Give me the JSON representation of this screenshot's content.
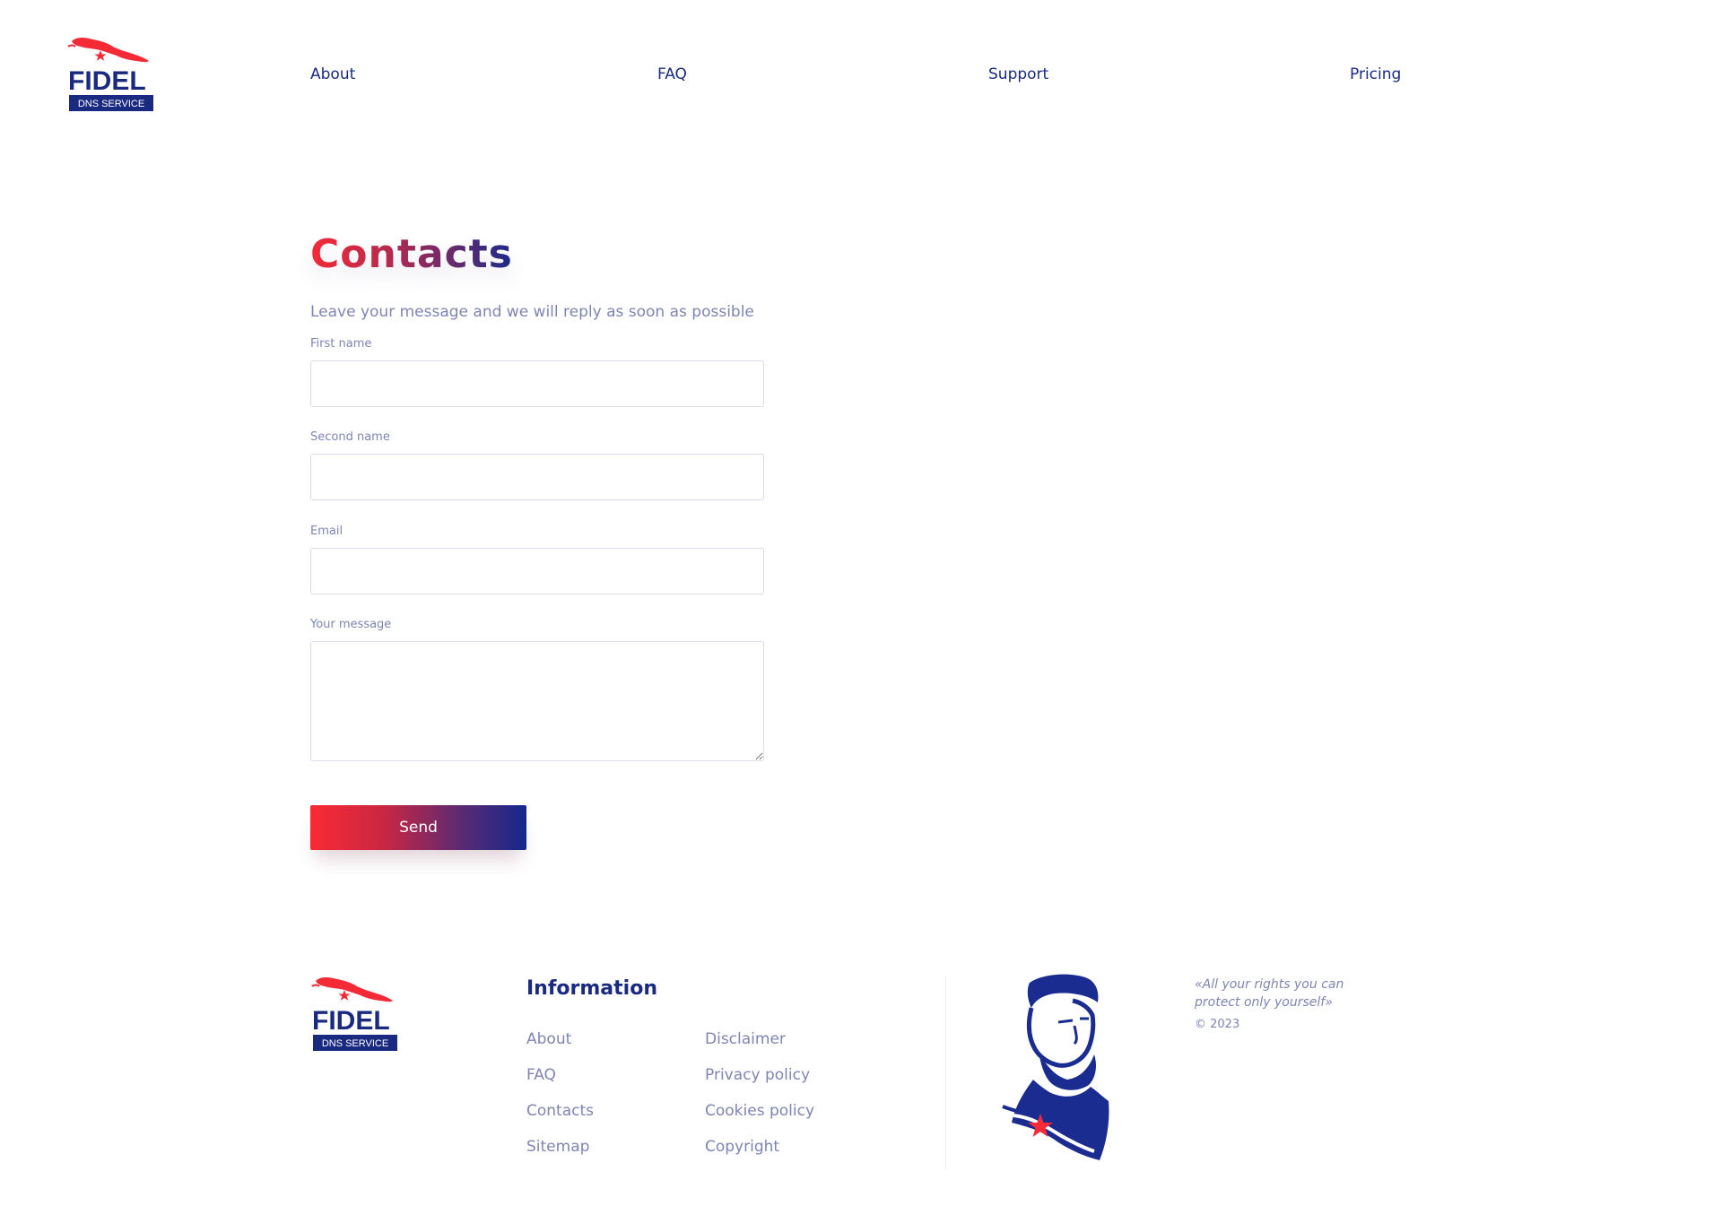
{
  "header": {
    "logo": {
      "word": "FIDEL",
      "tag": "DNS SERVICE"
    },
    "nav": [
      {
        "label": "About"
      },
      {
        "label": "FAQ"
      },
      {
        "label": "Support"
      },
      {
        "label": "Pricing"
      }
    ]
  },
  "contact": {
    "title": "Contacts",
    "subtitle": "Leave your message and we will reply as soon as possible",
    "fields": {
      "first_name": {
        "label": "First name",
        "value": ""
      },
      "second_name": {
        "label": "Second name",
        "value": ""
      },
      "email": {
        "label": "Email",
        "value": ""
      },
      "message": {
        "label": "Your message",
        "value": ""
      }
    },
    "send_label": "Send"
  },
  "footer": {
    "logo": {
      "word": "FIDEL",
      "tag": "DNS SERVICE"
    },
    "info_title": "Information",
    "links_col1": [
      "About",
      "FAQ",
      "Contacts",
      "Sitemap"
    ],
    "links_col2": [
      "Disclaimer",
      "Privacy policy",
      "Cookies policy",
      "Copyright"
    ],
    "quote": "«All your rights you can protect only yourself»",
    "copyright": "© 2023"
  },
  "colors": {
    "brand_blue": "#1a2a80",
    "brand_red": "#f52a37",
    "muted_text": "#7f85b3",
    "border": "#d9dcea"
  },
  "icons": {
    "logo": "cuba-island-with-star-icon",
    "portrait": "bearded-man-portrait-with-star-illustration"
  }
}
